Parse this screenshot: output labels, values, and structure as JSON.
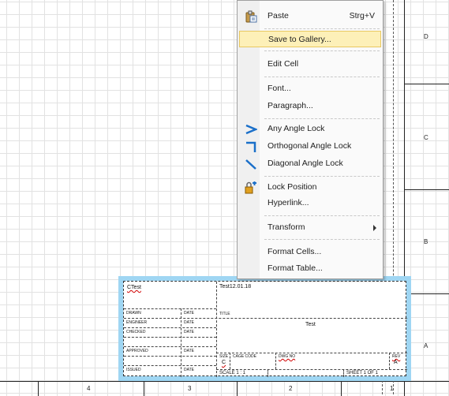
{
  "context_menu": {
    "items": [
      {
        "label": "Paste",
        "shortcut": "Strg+V",
        "icon": "paste-icon"
      },
      {
        "label": "Save to Gallery...",
        "highlighted": true
      },
      {
        "label": "Edit Cell"
      },
      {
        "label": "Font..."
      },
      {
        "label": "Paragraph..."
      },
      {
        "label": "Any Angle Lock",
        "icon": "any-angle-lock-icon"
      },
      {
        "label": "Orthogonal Angle Lock",
        "icon": "orthogonal-angle-lock-icon"
      },
      {
        "label": "Diagonal Angle Lock",
        "icon": "diagonal-angle-lock-icon"
      },
      {
        "label": "Lock Position",
        "icon": "lock-position-icon"
      },
      {
        "label": "Hyperlink..."
      },
      {
        "label": "Transform",
        "submenu": true
      },
      {
        "label": "Format Cells..."
      },
      {
        "label": "Format Table..."
      }
    ],
    "highlight_color": "#fdf0b8"
  },
  "zone_labels": {
    "rows": [
      "D",
      "C",
      "B",
      "A"
    ],
    "columns": [
      "4",
      "3",
      "2",
      "1"
    ]
  },
  "title_block": {
    "company": "CTest",
    "date_text": "Test12.01.18",
    "drawn": "DRAWN",
    "engineer": "ENGINEER",
    "checked": "CHECKED",
    "approved": "APPROVED",
    "issued": "ISSUED",
    "date_label": "DATE",
    "title_label": "TITLE",
    "title_value": "Test",
    "size_label": "SIZE",
    "size_value": "C",
    "code_label": "CAGE CODE",
    "dwg_label": "DWG NO",
    "rev_label": "REV",
    "rev_value": "A",
    "scale": "SCALE 1 : 1",
    "sheet": "SHEET 1 OF 1",
    "frame_color": "#9fd6f3"
  }
}
